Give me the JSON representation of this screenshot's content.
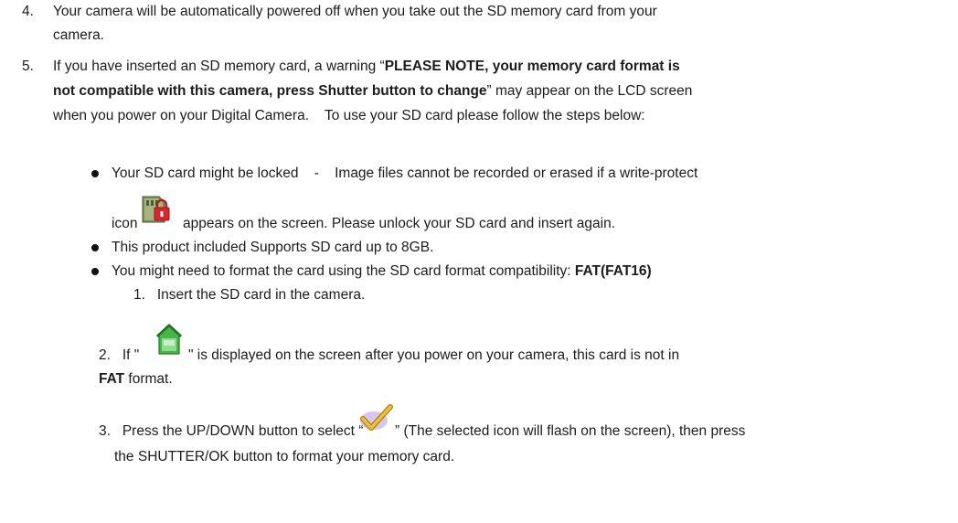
{
  "item4": {
    "number": "4.",
    "line1": "Your camera will be automatically powered off when you take out the SD memory card from your",
    "line2": "camera."
  },
  "item5": {
    "number": "5.",
    "l1_a": "If you have inserted an SD memory card, a warning “",
    "l1_bold": "PLEASE NOTE, your memory card format is",
    "l2_bold": "not compatible with this camera, press Shutter button to change",
    "l2_b": "” may appear on the LCD screen",
    "l3": "when you power on your Digital Camera.    To use your SD card please follow the steps below:"
  },
  "bullets": {
    "b1_line1": "Your SD card might be locked    -    Image files cannot be recorded or erased if a write-protect",
    "b1_icon_prefix": "icon",
    "b1_line2": "appears on the screen. Please unlock your SD card and insert again.",
    "b2": "This product included Supports SD card up to 8GB.",
    "b3_text": "You might need to format the card using the SD card format compatibility: ",
    "b3_bold": "FAT(FAT16)"
  },
  "steps": {
    "s1": "1.   Insert the SD card in the camera.",
    "s2_a": "2.   If \"",
    "s2_b": "\" is displayed on the screen after you power on your camera, this card is not in",
    "s2_bold": "FAT",
    "s2_c": " format.",
    "s3_a": "3.   Press the UP/DOWN button to select “",
    "s3_b": "” (The selected icon will flash on the screen), then press",
    "s3_line2": "the SHUTTER/OK button to format your memory card."
  },
  "icons": {
    "write_protect": "lock-card-icon",
    "not_fat": "green-card-icon",
    "confirm": "checkmark-icon"
  },
  "colors": {
    "text": "#1c1c1c",
    "lock_red": "#d8262a",
    "green_card": "#3cb43c",
    "check_purple": "#b8a4e0",
    "check_gold": "#d49a18"
  }
}
